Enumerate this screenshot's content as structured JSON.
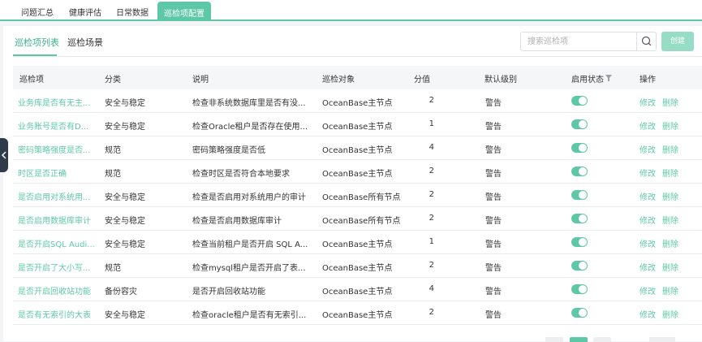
{
  "top_tabs": [
    "问题汇总",
    "健康评估",
    "日常数据",
    "巡检项配置"
  ],
  "sub_tabs": [
    "巡检项列表",
    "巡检场景"
  ],
  "search": {
    "placeholder": "搜索巡检项",
    "value": ""
  },
  "create_label": "创建",
  "columns": [
    "巡检项",
    "分类",
    "说明",
    "巡检对象",
    "分值",
    "默认级别",
    "启用状态",
    "操作"
  ],
  "rows": [
    {
      "name": "业务库是否有无主...",
      "category": "安全与稳定",
      "desc": "检查非系统数据库里是否有没...",
      "target": "OceanBase主节点",
      "score": "2",
      "level": "警告",
      "enabled": true
    },
    {
      "name": "业务账号是否有D...",
      "category": "安全与稳定",
      "desc": "检查Oracle租户是否存在使用...",
      "target": "OceanBase主节点",
      "score": "1",
      "level": "警告",
      "enabled": true
    },
    {
      "name": "密码策略强度是否...",
      "category": "规范",
      "desc": "密码策略强度是否低",
      "target": "OceanBase主节点",
      "score": "4",
      "level": "警告",
      "enabled": true
    },
    {
      "name": "时区是否正确",
      "category": "规范",
      "desc": "检查时区是否符合本地要求",
      "target": "OceanBase主节点",
      "score": "2",
      "level": "警告",
      "enabled": true
    },
    {
      "name": "是否启用对系统用...",
      "category": "安全与稳定",
      "desc": "检查是否启用对系统用户的审计",
      "target": "OceanBase所有节点",
      "score": "2",
      "level": "警告",
      "enabled": true
    },
    {
      "name": "是否启用数据库审计",
      "category": "安全与稳定",
      "desc": "检查是否启用数据库审计",
      "target": "OceanBase所有节点",
      "score": "2",
      "level": "警告",
      "enabled": true
    },
    {
      "name": "是否开启SQL Audi...",
      "category": "安全与稳定",
      "desc": "检查当前租户是否开启 SQL A...",
      "target": "OceanBase主节点",
      "score": "1",
      "level": "警告",
      "enabled": true
    },
    {
      "name": "是否开启了大小写...",
      "category": "规范",
      "desc": "检查mysql租户是否开启了表...",
      "target": "OceanBase主节点",
      "score": "2",
      "level": "警告",
      "enabled": true
    },
    {
      "name": "是否开启回收站功能",
      "category": "备份容灾",
      "desc": "是否开启回收站功能",
      "target": "OceanBase主节点",
      "score": "4",
      "level": "警告",
      "enabled": true
    },
    {
      "name": "是否有无索引的大表",
      "category": "安全与稳定",
      "desc": "检查oracle租户是否有无索引...",
      "target": "OceanBase主节点",
      "score": "2",
      "level": "警告",
      "enabled": true
    }
  ],
  "actions": {
    "edit": "修改",
    "delete": "删除"
  },
  "icons": [
    "search-icon",
    "filter-icon",
    "chevron-left-icon"
  ],
  "colors": {
    "accent": "#5ec8a6",
    "accent_light": "#97dcc4",
    "header_bg": "#f5f6f8"
  }
}
